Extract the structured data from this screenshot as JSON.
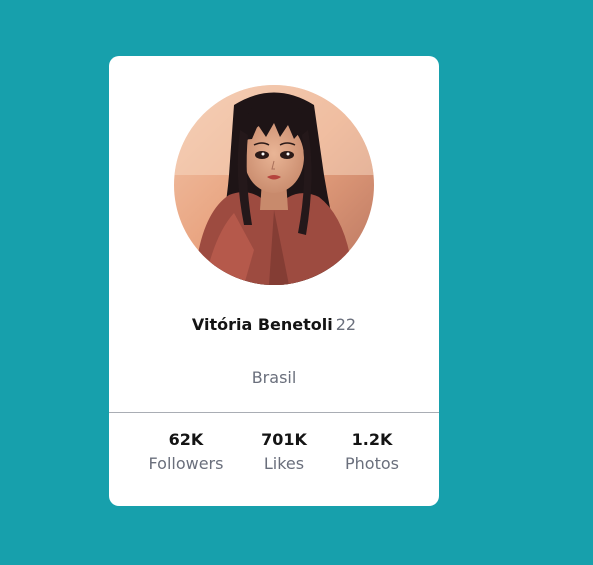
{
  "profile": {
    "name": "Vitória Benetoli",
    "age": "22",
    "location": "Brasil"
  },
  "stats": [
    {
      "value": "62K",
      "label": "Followers"
    },
    {
      "value": "701K",
      "label": "Likes"
    },
    {
      "value": "1.2K",
      "label": "Photos"
    }
  ],
  "colors": {
    "background": "#17a0ac",
    "card": "#ffffff",
    "muted_text": "#6a6f7c"
  }
}
